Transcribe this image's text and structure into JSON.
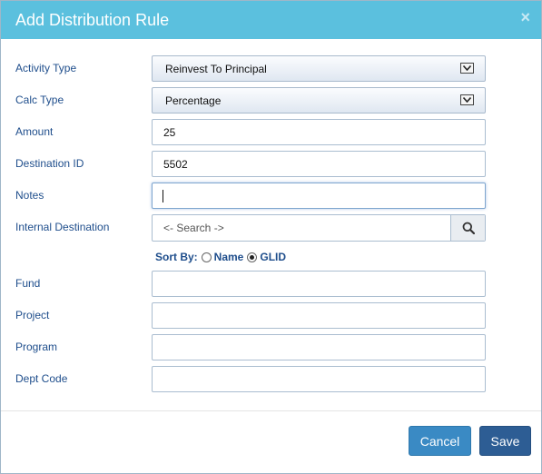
{
  "dialog": {
    "title": "Add Distribution Rule",
    "close_label": "×"
  },
  "form": {
    "activity_type": {
      "label": "Activity Type",
      "value": "Reinvest To Principal"
    },
    "calc_type": {
      "label": "Calc Type",
      "value": "Percentage"
    },
    "amount": {
      "label": "Amount",
      "value": "25"
    },
    "destination_id": {
      "label": "Destination ID",
      "value": "5502"
    },
    "notes": {
      "label": "Notes",
      "value": ""
    },
    "internal_destination": {
      "label": "Internal Destination",
      "placeholder": "<- Search ->"
    },
    "sort_by": {
      "label": "Sort By:",
      "options": [
        "Name",
        "GLID"
      ],
      "selected": "GLID"
    },
    "fund": {
      "label": "Fund",
      "value": ""
    },
    "project": {
      "label": "Project",
      "value": ""
    },
    "program": {
      "label": "Program",
      "value": ""
    },
    "dept_code": {
      "label": "Dept Code",
      "value": ""
    }
  },
  "buttons": {
    "cancel": "Cancel",
    "save": "Save"
  },
  "icons": {
    "search": "search-icon",
    "dropdown": "chevron-down-icon",
    "close": "close-icon"
  },
  "colors": {
    "header": "#5bc0de",
    "label": "#1f4e8c",
    "cancel_button": "#3a8ac4",
    "save_button": "#2d5d94"
  }
}
